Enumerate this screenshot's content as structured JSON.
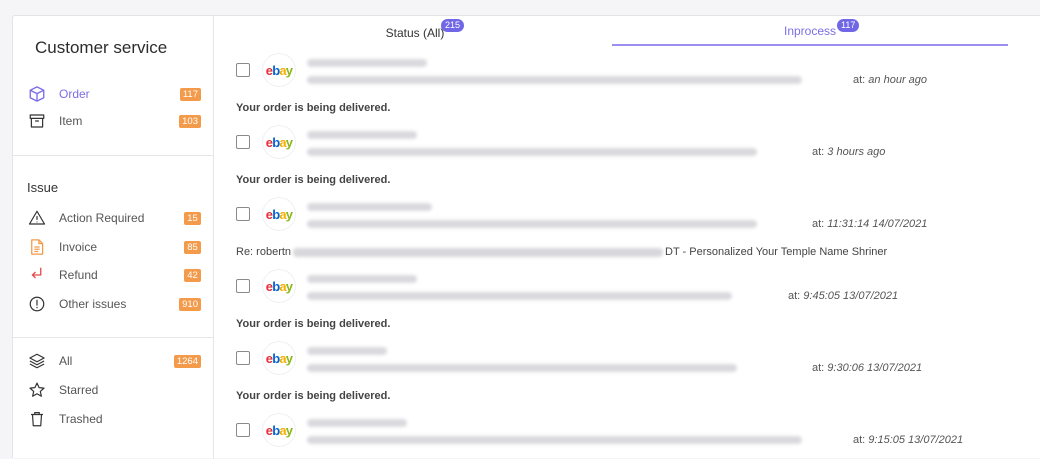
{
  "sidebar": {
    "title": "Customer service",
    "groups": [
      {
        "heading": "",
        "items": [
          {
            "label": "Order",
            "badge": "117",
            "icon": "package-icon",
            "active": true
          },
          {
            "label": "Item",
            "badge": "103",
            "icon": "archive-box-icon"
          }
        ]
      },
      {
        "heading": "Issue",
        "items": [
          {
            "label": "Action Required",
            "badge": "15",
            "icon": "warning-triangle-icon"
          },
          {
            "label": "Invoice",
            "badge": "85",
            "icon": "invoice-document-icon"
          },
          {
            "label": "Refund",
            "badge": "42",
            "icon": "return-arrow-icon"
          },
          {
            "label": "Other issues",
            "badge": "910",
            "icon": "alert-circle-icon"
          }
        ]
      },
      {
        "heading": "",
        "items": [
          {
            "label": "All",
            "badge": "1264",
            "icon": "layers-icon"
          },
          {
            "label": "Starred",
            "badge": "",
            "icon": "star-icon"
          },
          {
            "label": "Trashed",
            "badge": "",
            "icon": "trash-icon"
          }
        ]
      }
    ]
  },
  "tabs": [
    {
      "label": "Status (All)",
      "count": "215",
      "active": false
    },
    {
      "label": "Inprocess",
      "count": "117",
      "active": true
    }
  ],
  "messages": [
    {
      "sender_icon": "ebay-logo",
      "time_prefix": "at:",
      "time": "an hour ago",
      "preview": "Your order is being delivered."
    },
    {
      "sender_icon": "ebay-logo",
      "time_prefix": "at:",
      "time": "3 hours ago",
      "preview": "Your order is being delivered."
    },
    {
      "sender_icon": "ebay-logo",
      "time_prefix": "at:",
      "time": "11:31:14 14/07/2021",
      "preview_prefix": "Re: robertn",
      "preview_suffix": "DT - Personalized Your Temple Name Shriner"
    },
    {
      "sender_icon": "ebay-logo",
      "time_prefix": "at:",
      "time": "9:45:05 13/07/2021",
      "preview": "Your order is being delivered."
    },
    {
      "sender_icon": "ebay-logo",
      "time_prefix": "at:",
      "time": "9:30:06 13/07/2021",
      "preview": "Your order is being delivered."
    },
    {
      "sender_icon": "ebay-logo",
      "time_prefix": "at:",
      "time": "9:15:05 13/07/2021",
      "preview": ""
    }
  ],
  "colors": {
    "accent": "#7c6ee6",
    "badge": "#f39a4b",
    "tab_count": "#7167e6",
    "refund_icon": "#e84b4b",
    "invoice_icon": "#f39a4b"
  }
}
